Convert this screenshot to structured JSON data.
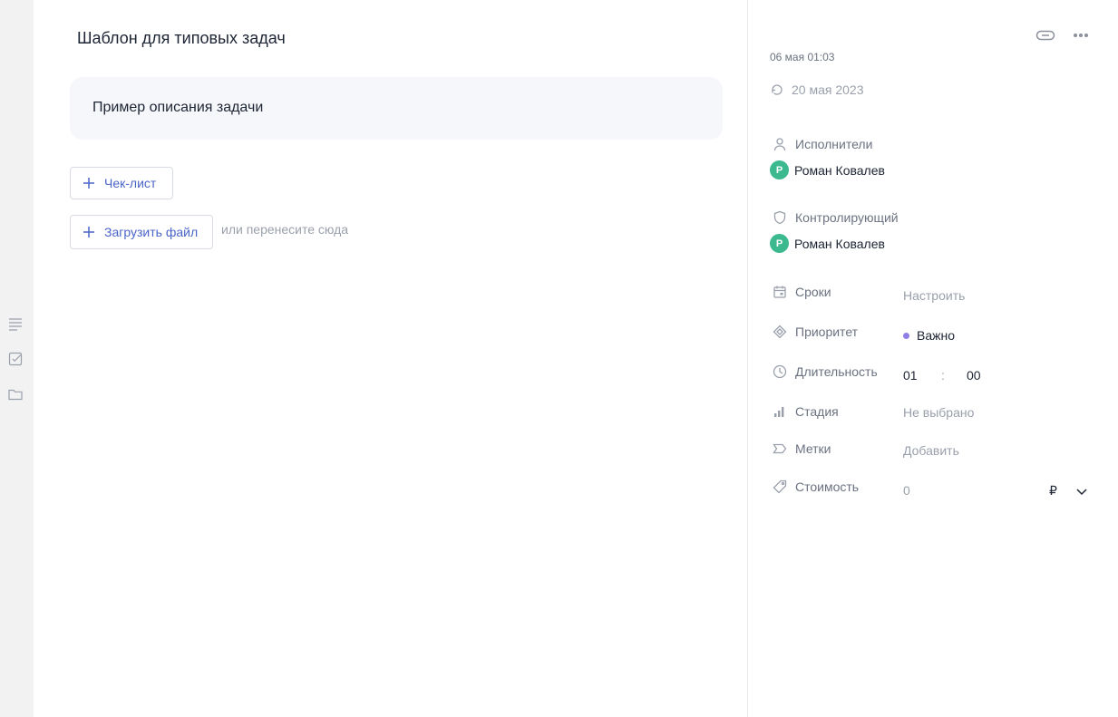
{
  "task": {
    "title": "Шаблон для типовых задач",
    "description": "Пример описания задачи"
  },
  "actions": {
    "checklist_label": "Чек-лист",
    "upload_label": "Загрузить файл",
    "drop_hint": "или перенесите сюда"
  },
  "left_rail": {
    "icons": [
      "description-icon",
      "checklist-icon",
      "folder-icon"
    ]
  },
  "side": {
    "top_icons": [
      "link-icon",
      "more-icon"
    ],
    "created": "06 мая 01:03",
    "updated": "20 мая 2023",
    "assignees_label": "Исполнители",
    "assignee_initial": "Р",
    "assignee_name": "Роман Ковалев",
    "controller_label": "Контролирующий",
    "controller_initial": "Р",
    "controller_name": "Роман Ковалев",
    "fields": {
      "deadline_label": "Сроки",
      "deadline_value": "Настроить",
      "priority_label": "Приоритет",
      "priority_value": "Важно",
      "duration_label": "Длительность",
      "duration_hours": "01",
      "duration_sep": ":",
      "duration_minutes": "00",
      "stage_label": "Стадия",
      "stage_value": "Не выбрано",
      "tags_label": "Метки",
      "tags_value": "Добавить",
      "cost_label": "Стоимость",
      "cost_value": "0",
      "currency": "₽"
    }
  },
  "colors": {
    "accent": "#4a64c8",
    "avatar": "#3cb98e",
    "priority_dot": "#8f7ee7",
    "description_bg": "#f5f7fb"
  }
}
